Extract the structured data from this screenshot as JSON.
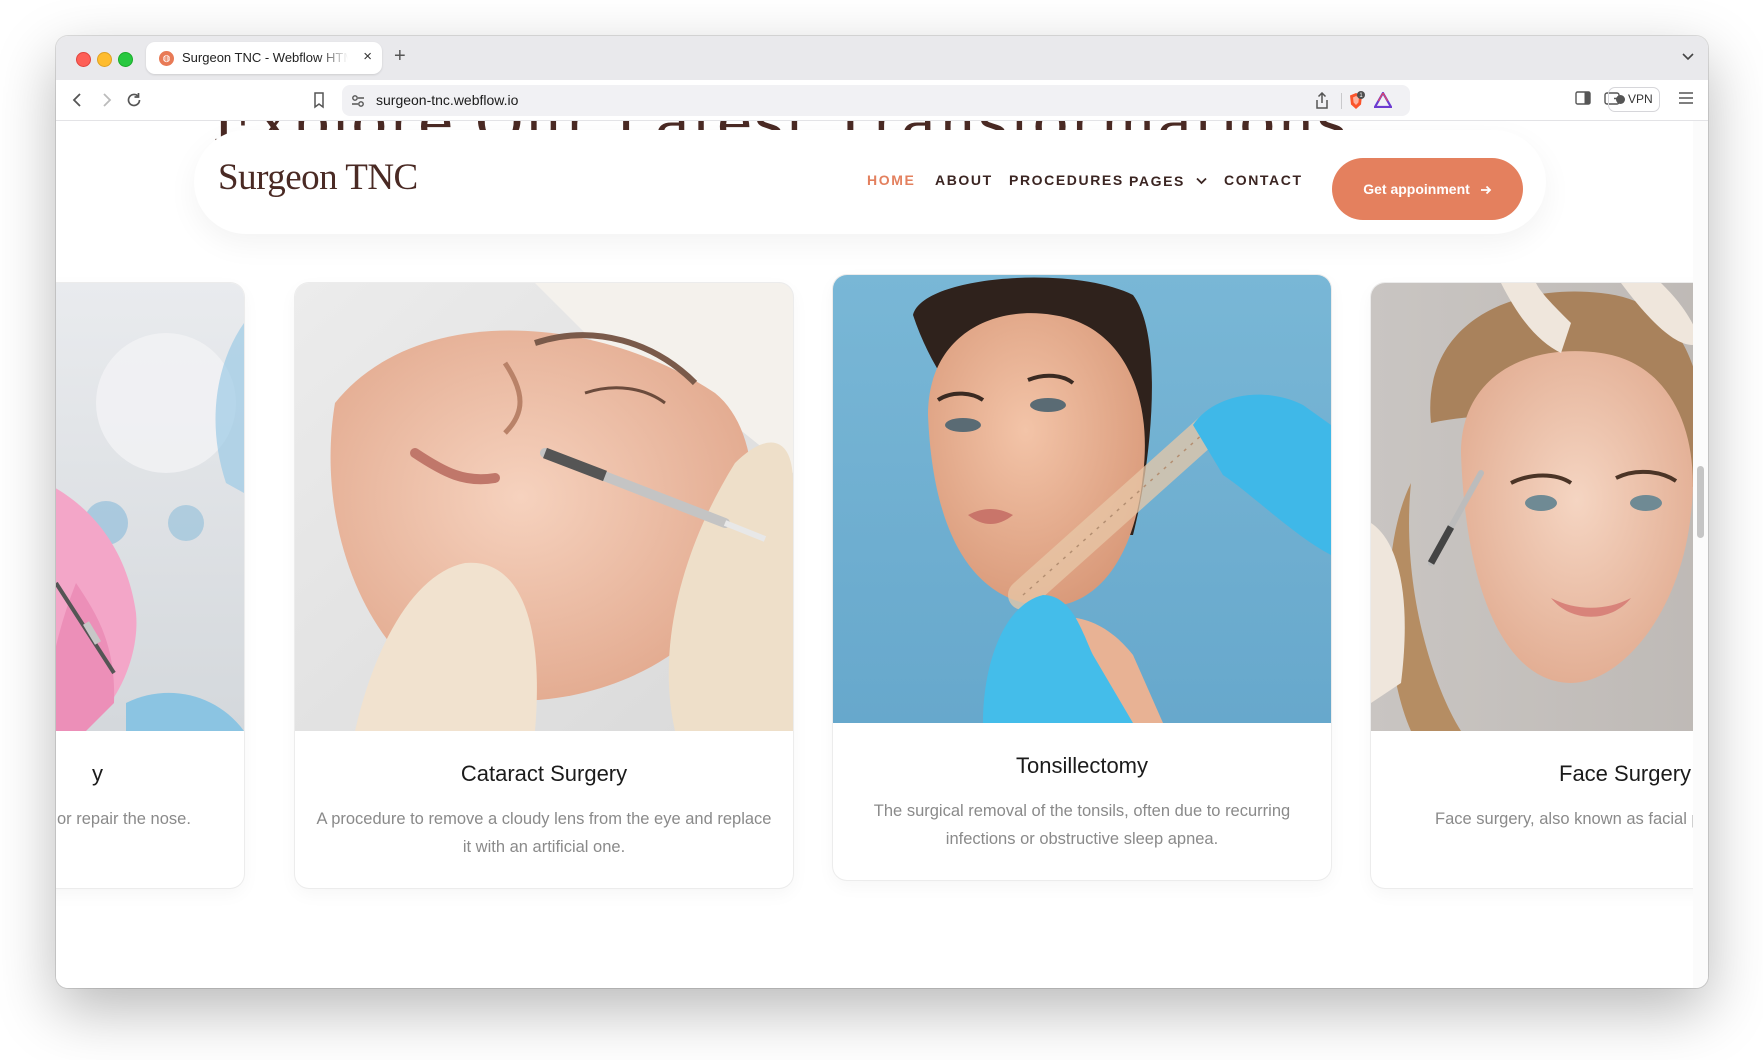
{
  "browser": {
    "tab_title": "Surgeon TNC - Webflow HTML website template",
    "tab_favicon": "surgeon-tnc-favicon",
    "url": "surgeon-tnc.webflow.io",
    "vpn_label": "VPN",
    "shield_badge": "1"
  },
  "site": {
    "background_heading": "Explore Our Latest Transformations",
    "logo": "Surgeon TNC",
    "nav": {
      "home": "HOME",
      "about": "ABOUT",
      "procedures": "PROCEDURES",
      "pages": "PAGES",
      "contact": "CONTACT"
    },
    "cta_label": "Get appoinment",
    "accent_color": "#e4805e",
    "heading_color": "#4a2a24"
  },
  "cards": [
    {
      "title": "Rhinoplasty",
      "visible_title": "y",
      "desc": "A surgical procedure to reshape or repair the nose.",
      "visible_desc": "or repair the nose."
    },
    {
      "title": "Cataract Surgery",
      "desc": "A procedure to remove a cloudy lens from the eye and replace it with an artificial one."
    },
    {
      "title": "Tonsillectomy",
      "desc": "The surgical removal of the tonsils, often due to recurring infections or obstructive sleep apnea."
    },
    {
      "title": "Face Surgery",
      "desc": "Face surgery, also known as facial plastic surgery",
      "visible_desc": "Face surgery, also known as facial p"
    }
  ]
}
